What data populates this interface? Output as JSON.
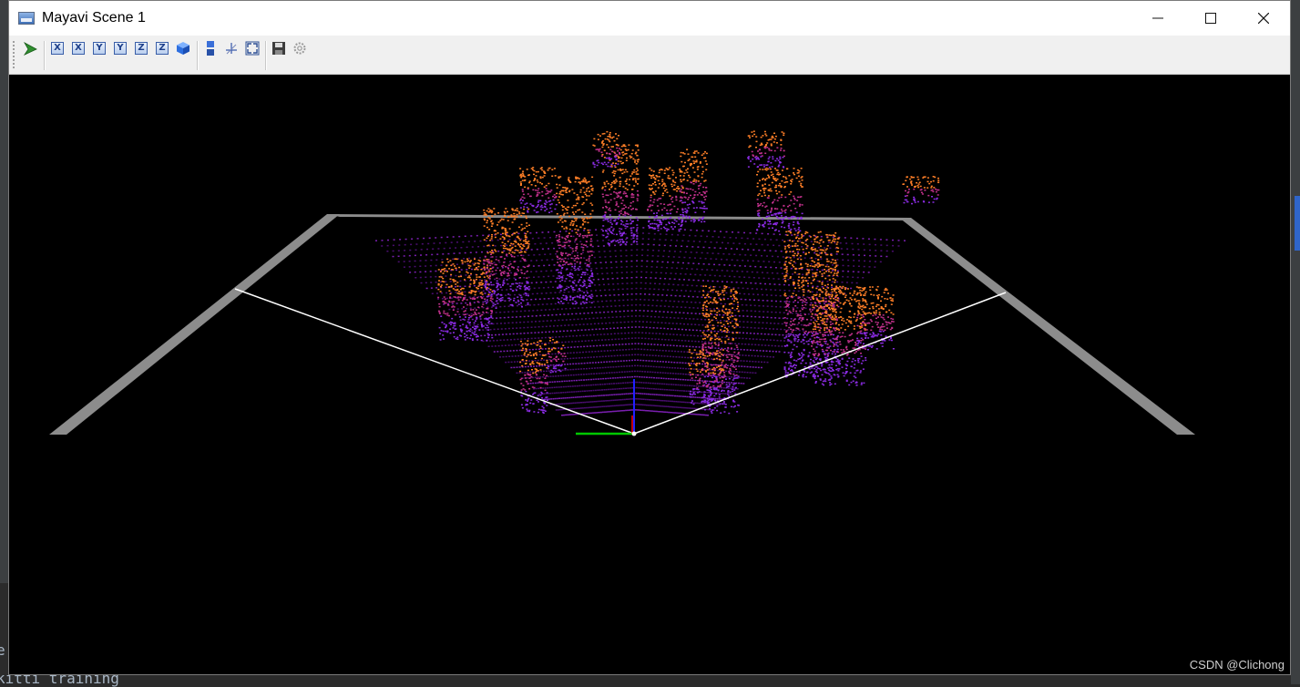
{
  "window": {
    "title": "Mayavi Scene 1",
    "controls": {
      "minimize": "—",
      "maximize": "☐",
      "close": "✕"
    }
  },
  "toolbar": {
    "buttons": [
      {
        "name": "pipeline-icon"
      },
      {
        "name": "view-x-plus",
        "label": "X"
      },
      {
        "name": "view-x-minus",
        "label": "X"
      },
      {
        "name": "view-y-plus",
        "label": "Y"
      },
      {
        "name": "view-y-minus",
        "label": "Y"
      },
      {
        "name": "view-z-plus",
        "label": "Z"
      },
      {
        "name": "view-z-minus",
        "label": "Z"
      },
      {
        "name": "isometric-view"
      },
      {
        "name": "parallel-projection"
      },
      {
        "name": "axes-indicator"
      },
      {
        "name": "full-screen"
      },
      {
        "name": "save-icon"
      },
      {
        "name": "configure-icon"
      }
    ]
  },
  "background": {
    "terminal_line": "kitti training",
    "terminal_fragment": "e"
  },
  "watermark": "CSDN @Clichong",
  "colors": {
    "scene_bg": "#000000",
    "grid_plane": "#8c8c8c",
    "fov_lines": "#ffffff",
    "points_low": "#8a2be2",
    "points_high": "#ff7f27",
    "axis_x": "#00c800",
    "axis_y": "#2020ff",
    "axis_z": "#ff0000"
  }
}
